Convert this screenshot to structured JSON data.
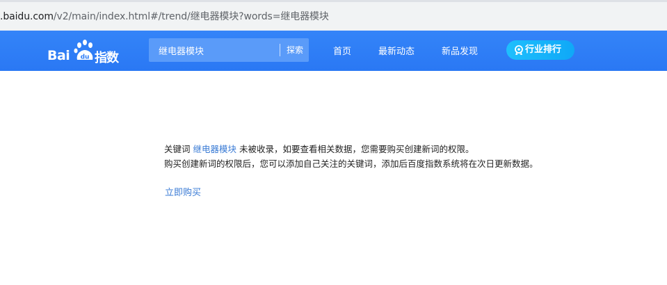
{
  "browser": {
    "url_host": ".baidu.com",
    "url_path": "/v2/main/index.html#/trend/继电器模块?words=继电器模块"
  },
  "header": {
    "logo_text_left": "Bai",
    "logo_paw_text": "du",
    "logo_text_right": "指数",
    "search": {
      "value": "继电器模块",
      "button_label": "探索"
    },
    "nav": {
      "home": "首页",
      "news": "最新动态",
      "new_products": "新品发现"
    },
    "rank_button": {
      "label": "行业排行",
      "icon": "rank-badge-icon"
    },
    "colors": {
      "bar": "#2e7df7",
      "rank_button": "#17b4fb"
    }
  },
  "message": {
    "line1_prefix": "关键词 ",
    "keyword": "继电器模块",
    "line1_suffix": " 未被收录，如要查看相关数据，您需要购买创建新词的权限。",
    "line2": "购买创建新词的权限后，您可以添加自己关注的关键词，添加后百度指数系统将在次日更新数据。",
    "buy_link": "立即购买"
  }
}
